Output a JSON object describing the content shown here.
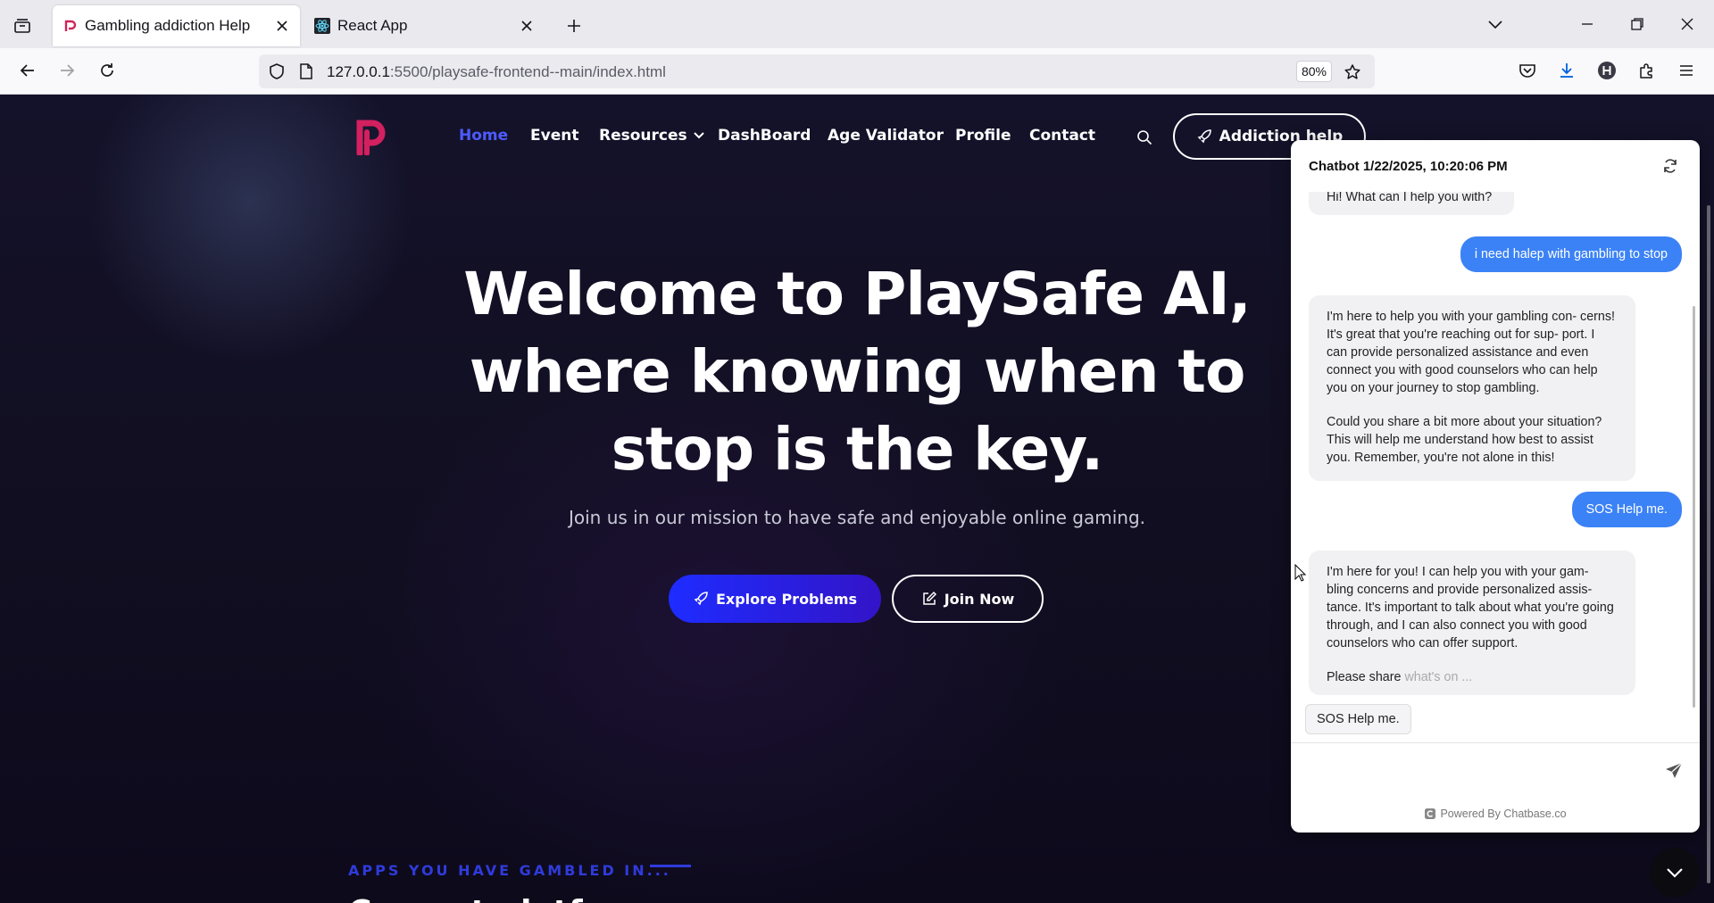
{
  "browser": {
    "tabs": [
      {
        "title": "Gambling addiction Help",
        "active": true
      },
      {
        "title": "React App",
        "active": false
      }
    ],
    "url_host": "127.0.0.1",
    "url_path": ":5500/playsafe-frontend--main/index.html",
    "zoom": "80%"
  },
  "site": {
    "nav": {
      "home": "Home",
      "event": "Event",
      "resources": "Resources",
      "dashboard": "DashBoard",
      "age_validator": "Age Validator",
      "profile": "Profile",
      "contact": "Contact",
      "addiction_help": "Addiction help"
    },
    "hero": {
      "title_line1": "Welcome to PlaySafe AI,",
      "title_line2": "where knowing when to",
      "title_line3": "stop is the key.",
      "subtitle": "Join us in our mission to have safe and enjoyable online gaming.",
      "explore_button": "Explore Problems",
      "join_button": "Join Now"
    },
    "apps_section": {
      "label": "APPS YOU HAVE GAMBLED IN...",
      "heading_partial": "Current platf..."
    }
  },
  "chatbot": {
    "header": "Chatbot 1/22/2025, 10:20:06 PM",
    "messages": [
      {
        "from": "bot",
        "text": "Hi! What can I help you with?"
      },
      {
        "from": "user",
        "text": "i need halep with gambling to stop"
      },
      {
        "from": "bot",
        "text": "I'm here to help you with your gambling con- cerns! It's great that you're reaching out for sup- port. I can provide personalized assistance and even connect you with good counselors who can help you on your journey to stop gambling."
      },
      {
        "from": "bot",
        "text": "Could you share a bit more about your situation? This will help me understand how best to assist you. Remember, you're not alone in this!"
      },
      {
        "from": "user",
        "text": "SOS Help me."
      },
      {
        "from": "bot",
        "text": "I'm here for you! I can help you with your gam- bling concerns and provide personalized assis- tance. It's important to talk about what you're going through, and I can also connect you with good counselors who can offer support."
      },
      {
        "from": "bot",
        "text": "Please share",
        "faded": "what's on ..."
      }
    ],
    "quick_reply": "SOS Help me.",
    "powered_by": "Powered By Chatbase.co"
  }
}
